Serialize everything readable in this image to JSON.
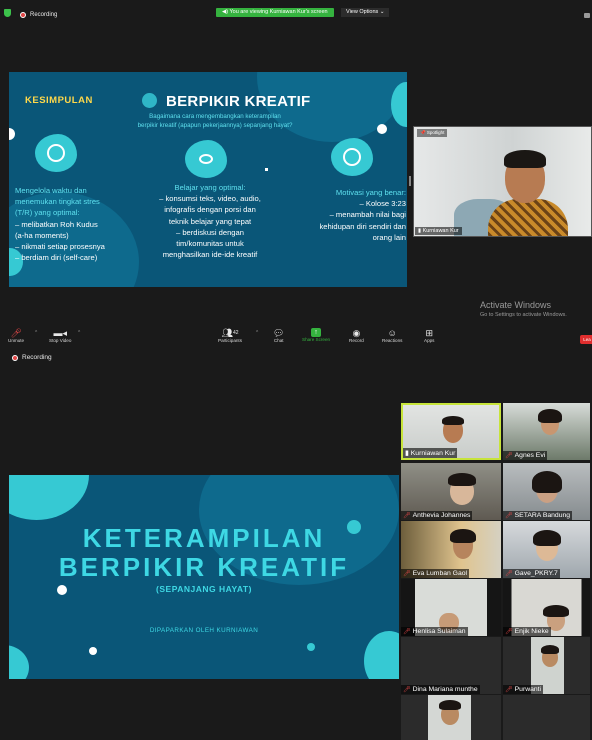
{
  "top": {
    "recording_label": "Recording",
    "share_banner": "You are viewing Kurniawan Kur's screen",
    "view_options": "View Options ⌄",
    "slide": {
      "kesimpulan": "KESIMPULAN",
      "title": "BERPIKIR KREATIF",
      "subtitle_1": "Bagaimana cara mengembangkan keterampilan",
      "subtitle_2": "berpikir kreatif (apapun pekerjaannya) sepanjang hayat?",
      "left": {
        "h1": "Mengelola waktu dan",
        "h2": "menemukan tingkat stres",
        "h3": "(T/R) yang optimal:",
        "l1": "– melibatkan Roh Kudus",
        "l2": "(a-ha moments)",
        "l3": "– nikmati setiap prosesnya",
        "l4": "– berdiam diri (self-care)"
      },
      "middle": {
        "h1": "Belajar yang optimal:",
        "l1": "– konsumsi teks, video, audio,",
        "l2": "infografis dengan porsi dan",
        "l3": "teknik belajar yang tepat",
        "l4": "– berdiskusi dengan",
        "l5": "tim/komunitas untuk",
        "l6": "menghasilkan ide-ide kreatif"
      },
      "right": {
        "h1": "Motivasi yang benar:",
        "l1": "– Kolose 3:23",
        "l2": "– menambah nilai bagi",
        "l3": "kehidupan diri sendiri dan",
        "l4": "orang lain"
      }
    },
    "video": {
      "tag": "Spotlight",
      "name": "Kurniawan Kur"
    },
    "activate": {
      "title": "Activate Windows",
      "subtitle": "Go to Settings to activate Windows."
    },
    "toolbar": {
      "unmute": "Unmute",
      "stop_video": "Stop Video",
      "participants_count": "42",
      "participants": "Participants",
      "chat": "Chat",
      "share_screen": "Share Screen",
      "record": "Record",
      "reactions": "Reactions",
      "apps": "Apps",
      "leave": "Lea"
    }
  },
  "bottom": {
    "recording_label": "Recording",
    "slide": {
      "title_1": "KETERAMPILAN",
      "title_2": "BERPIKIR KREATIF",
      "subtitle": "(SEPANJANG HAYAT)",
      "presenter": "DIPAPARKAN OLEH KURNIAWAN"
    },
    "participants": [
      {
        "name": "Kurniawan Kur",
        "muted": false
      },
      {
        "name": "Agnes Evi",
        "muted": true
      },
      {
        "name": "Anthevia Johannes",
        "muted": true
      },
      {
        "name": "SETARA Bandung",
        "muted": true
      },
      {
        "name": "Eva Lumban Gaol",
        "muted": true
      },
      {
        "name": "Gave_PKRY.7",
        "muted": true
      },
      {
        "name": "Henlisa Sulaiman",
        "muted": true
      },
      {
        "name": "Enjik Nieke",
        "muted": true
      },
      {
        "name": "Dina Mariana munthe",
        "muted": true
      },
      {
        "name": "Purwanti",
        "muted": true
      }
    ]
  },
  "colors": {
    "slide_bg": "#0a5678",
    "slide_accent": "#3ed8e4",
    "kesimpulan": "#ffd84a",
    "share_green": "#35b33f",
    "active_speaker": "#c7e43a",
    "leave_red": "#e02e2e"
  }
}
